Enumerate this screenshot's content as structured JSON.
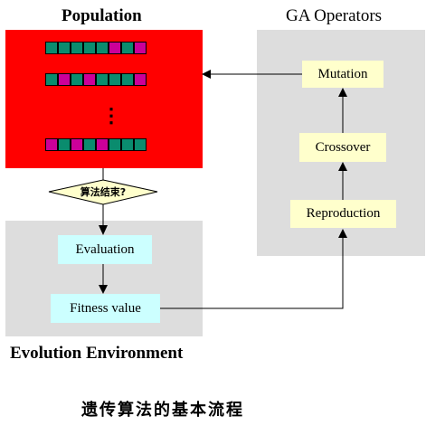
{
  "population": {
    "title": "Population",
    "ellipsis": "⋮",
    "rows": [
      [
        "t",
        "t",
        "t",
        "t",
        "t",
        "m",
        "t",
        "m"
      ],
      [
        "t",
        "m",
        "t",
        "m",
        "t",
        "t",
        "t",
        "m"
      ],
      [
        "m",
        "t",
        "m",
        "t",
        "m",
        "t",
        "t",
        "t"
      ]
    ]
  },
  "ga_operators": {
    "title": "GA Operators",
    "mutation": "Mutation",
    "crossover": "Crossover",
    "reproduction": "Reproduction"
  },
  "decision": {
    "label": "算法结束?"
  },
  "environment": {
    "title": "Evolution Environment",
    "evaluation": "Evaluation",
    "fitness": "Fitness value"
  },
  "caption": "遗传算法的基本流程",
  "colors": {
    "population_bg": "#ff0000",
    "panel_gray": "#dddddd",
    "operator_box": "#ffffcc",
    "env_box": "#ccffff",
    "decision_fill": "#ffffcc",
    "gene_teal": "#0a8c6e",
    "gene_magenta": "#cc0099"
  }
}
